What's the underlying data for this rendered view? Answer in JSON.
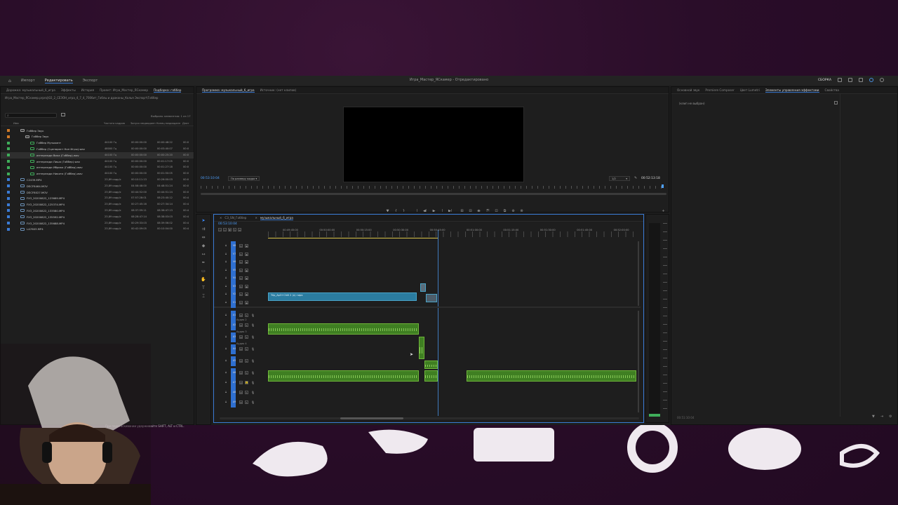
{
  "app": {
    "title": "Игра_Мастер_ЯСкамер - Отредактировано",
    "menu": [
      "Импорт",
      "Редактировать",
      "Экспорт"
    ],
    "active_menu": "Редактировать",
    "right_label": "СБОРКА"
  },
  "project_panel": {
    "tabs": [
      "Дорожка: музыкальный_6_игра",
      "Эффекты",
      "История",
      "Проект: Игра_Мастер_ЯСкамер",
      "Подборка: гоббер"
    ],
    "path": "Игра_Мастер_ЯСкамер.prproj\\02_2_СЕЗОН_игра_4_7_4_700бит_Гоблы и драконы_Колья Экспорт\\Гоббер",
    "item_count": "Выбрано элементов: 1 из 17",
    "columns": [
      "Имя",
      "Частота кадров",
      "Запуск медиаданн",
      "Конец медиаданн",
      "Длит"
    ],
    "rows": [
      {
        "name": "Гоббер Звук",
        "rate": "",
        "start": "",
        "end": "",
        "dur": "",
        "type": "folder",
        "chip": "#d07a28",
        "indent": 0
      },
      {
        "name": "Гоббер Звук",
        "rate": "",
        "start": "",
        "end": "",
        "dur": "",
        "type": "folder",
        "chip": "#d07a28",
        "indent": 1
      },
      {
        "name": "Гоббер Музыкант",
        "rate": "44100 Гц",
        "start": "00:00:00:00",
        "end": "00:00:48:22",
        "dur": "00:0",
        "type": "audio",
        "chip": "#3fae5a",
        "indent": 2
      },
      {
        "name": "Гоббер (Сценарист Нон Игры).wav",
        "rate": "48000 Гц",
        "start": "00:00:00:00",
        "end": "00:03:40:07",
        "dur": "00:0",
        "type": "audio",
        "chip": "#3fae5a",
        "indent": 2
      },
      {
        "name": "интерлюди Вика (Гоббер).wav",
        "rate": "44100 Гц",
        "start": "00:00:00:00",
        "end": "00:00:25:20",
        "dur": "00:0",
        "type": "audio",
        "chip": "#3fae5a",
        "indent": 2,
        "selected": true
      },
      {
        "name": "интерлюди Лиша (Гоббер).wav",
        "rate": "44100 Гц",
        "start": "00:00:00:00",
        "end": "00:01:17:05",
        "dur": "00:0",
        "type": "audio",
        "chip": "#3fae5a",
        "indent": 2
      },
      {
        "name": "интерлюди Ибрика (Гоббер).wav",
        "rate": "44100 Гц",
        "start": "00:00:00:00",
        "end": "00:01:27:18",
        "dur": "00:0",
        "type": "audio",
        "chip": "#3fae5a",
        "indent": 2
      },
      {
        "name": "интерлюди Никита (Гоббер).wav",
        "rate": "44100 Гц",
        "start": "00:00:00:00",
        "end": "00:01:50:05",
        "dur": "00:0",
        "type": "audio",
        "chip": "#3fae5a",
        "indent": 2
      },
      {
        "name": "C2439.MP4",
        "rate": "23,89 кадр/с",
        "start": "00:10:11:13",
        "end": "00:26:00:03",
        "dur": "00:0",
        "type": "video",
        "chip": "#3a7bd5",
        "indent": 0
      },
      {
        "name": "DSCF8464.MOV",
        "rate": "23,89 кадр/с",
        "start": "04:58:48:00",
        "end": "04:48:51:24",
        "dur": "00:0",
        "type": "video",
        "chip": "#3a7bd5",
        "indent": 0
      },
      {
        "name": "DSCF8027.MOV",
        "rate": "23,89 кадр/с",
        "start": "00:44:52:00",
        "end": "00:44:51:24",
        "dur": "00:0",
        "type": "video",
        "chip": "#3a7bd5",
        "indent": 0
      },
      {
        "name": "FX3_20200822_123669.MP4",
        "rate": "23,89 кадр/с",
        "start": "07:57:28:01",
        "end": "08:23:40:12",
        "dur": "00:4",
        "type": "video",
        "chip": "#3a7bd5",
        "indent": 0
      },
      {
        "name": "FX3_20200822_125374.MP4",
        "rate": "23,89 кадр/с",
        "start": "00:27:45:16",
        "end": "00:27:34:14",
        "dur": "00:4",
        "type": "video",
        "chip": "#3a7bd5",
        "indent": 0
      },
      {
        "name": "FX3_20200822_133580.MP4",
        "rate": "23,89 кадр/с",
        "start": "08:37:59:11",
        "end": "08:36:47:13",
        "dur": "00:4",
        "type": "video",
        "chip": "#3a7bd5",
        "indent": 0
      },
      {
        "name": "FX3_20200822_135592.MP4",
        "rate": "23,89 кадр/с",
        "start": "08:28:47:14",
        "end": "08:38:03:03",
        "dur": "00:4",
        "type": "video",
        "chip": "#3a7bd5",
        "indent": 0
      },
      {
        "name": "FX3_20200822_135688.MP4",
        "rate": "23,89 кадр/с",
        "start": "00:29:33:03",
        "end": "08:39:56:02",
        "dur": "00:4",
        "type": "video",
        "chip": "#3a7bd5",
        "indent": 0
      },
      {
        "name": "LA7603.MP4",
        "rate": "23,89 кадр/с",
        "start": "00:42:09:05",
        "end": "00:10:04:00",
        "dur": "00:4",
        "type": "video",
        "chip": "#3a7bd5",
        "indent": 0
      }
    ]
  },
  "program_monitor": {
    "tabs": [
      "Программа: музыкальный_6_игра",
      "Источник: (нет клипов)"
    ],
    "timecode_left": "00:53:10:04",
    "fit": "По размеру кадра",
    "quality": "1/2",
    "timecode_right": "00:52:13:18",
    "buttons": [
      "▼",
      "{",
      "}",
      "|◀",
      "◀|",
      "▶",
      "|▶",
      "▶|",
      "⊞",
      "⊟",
      "◉",
      "⎘",
      "⊡",
      "⧉",
      "⊕",
      "⊗",
      "+"
    ]
  },
  "timeline": {
    "tabs": [
      "C3_SN_Гоббер",
      "музыкальный_6_игра"
    ],
    "timecode": "00:53:10:04",
    "ruler": [
      "00:49:45:00",
      "00:50:00:00",
      "00:50:15:00",
      "00:50:30:00",
      "00:50:45:00",
      "00:51:00:00",
      "00:51:15:00",
      "00:51:30:00",
      "00:51:45:00",
      "00:52:00:00"
    ],
    "video_tracks": [
      "V8",
      "V7",
      "V6",
      "V5",
      "V4",
      "V3",
      "V2",
      "V1"
    ],
    "audio_tracks": [
      "A1",
      "A2",
      "A3",
      "A4",
      "A5",
      "A6",
      "A7",
      "A8",
      "A9"
    ],
    "audio_names": [
      "Аудио 2",
      "Аудио 3",
      "Аудио 4"
    ],
    "video_clip": "Trip_Ap3+Chill 2 (x) гиря",
    "cursor_hint": "",
    "status": "При перетаскивании удерживайте SHIFT, ALT и CTRL."
  },
  "right_panel": {
    "tabs": [
      "Основной звук",
      "Premiere Composer",
      "Цвет Lumetri",
      "Элементы управления эффектами",
      "Свойства"
    ],
    "active_tab": "Элементы управления эффектами",
    "empty_label": "(клип не выбран)",
    "timecode": "00:51:10:04"
  }
}
